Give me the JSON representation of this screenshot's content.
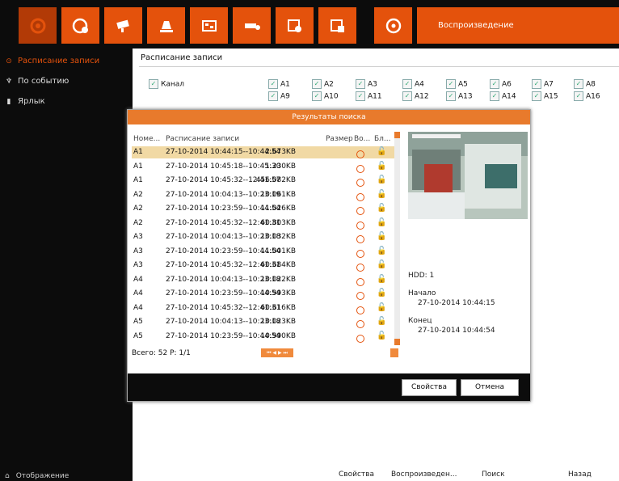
{
  "toolbar": {
    "title": "Воспроизведение",
    "buttons": [
      "playback-icon",
      "display-icon",
      "camera-icon",
      "alarm-icon",
      "network-icon",
      "hdd-icon",
      "settings-icon",
      "system-icon",
      "power-icon"
    ]
  },
  "sidebar": {
    "items": [
      {
        "label": "Расписание записи",
        "selected": true
      },
      {
        "label": "По событию",
        "selected": false
      },
      {
        "label": "Ярлык",
        "selected": false
      }
    ],
    "bottom_label": "Отображение"
  },
  "content": {
    "title": "Расписание записи",
    "channel_label": "Канал",
    "channels": [
      "A1",
      "A2",
      "A3",
      "A4",
      "A5",
      "A6",
      "A7",
      "A8",
      "A9",
      "A10",
      "A11",
      "A12",
      "A13",
      "A14",
      "A15",
      "A16"
    ]
  },
  "dialog": {
    "title": "Результаты поиска",
    "columns": [
      "Номе...",
      "Расписание записи",
      "Размер",
      "Во...",
      "Бл..."
    ],
    "rows": [
      {
        "ch": "A1",
        "time": "27-10-2014 10:44:15--10:44:54",
        "size": "2.673KB"
      },
      {
        "ch": "A1",
        "time": "27-10-2014 10:45:18--10:45:30",
        "size": "1.230KB"
      },
      {
        "ch": "A1",
        "time": "27-10-2014 10:45:32--12:41:57",
        "size": "456.082KB"
      },
      {
        "ch": "A2",
        "time": "27-10-2014 10:04:13--10:23:19",
        "size": "10.061KB"
      },
      {
        "ch": "A2",
        "time": "27-10-2014 10:23:59--10:44:54",
        "size": "11.026KB"
      },
      {
        "ch": "A2",
        "time": "27-10-2014 10:45:32--12:41:31",
        "size": "60.803KB"
      },
      {
        "ch": "A3",
        "time": "27-10-2014 10:04:13--10:23:18",
        "size": "10.032KB"
      },
      {
        "ch": "A3",
        "time": "27-10-2014 10:23:59--10:44:54",
        "size": "11.001KB"
      },
      {
        "ch": "A3",
        "time": "27-10-2014 10:45:32--12:41:31",
        "size": "60.684KB"
      },
      {
        "ch": "A4",
        "time": "27-10-2014 10:04:13--10:23:18",
        "size": "10.022KB"
      },
      {
        "ch": "A4",
        "time": "27-10-2014 10:23:59--10:44:54",
        "size": "10.993KB"
      },
      {
        "ch": "A4",
        "time": "27-10-2014 10:45:32--12:41:31",
        "size": "60.616KB"
      },
      {
        "ch": "A5",
        "time": "27-10-2014 10:04:13--10:23:18",
        "size": "10.023KB"
      },
      {
        "ch": "A5",
        "time": "27-10-2014 10:23:59--10:44:54",
        "size": "10.990KB"
      }
    ],
    "total": "Всего: 52  P: 1/1",
    "hdd": "HDD: 1",
    "start_label": "Начало",
    "start_value": "27-10-2014 10:44:15",
    "end_label": "Конец",
    "end_value": "27-10-2014 10:44:54",
    "properties_button": "Свойства",
    "cancel_button": "Отмена"
  },
  "bottom": {
    "properties": "Свойства",
    "playback": "Воспроизведен...",
    "search": "Поиск",
    "back": "Назад"
  }
}
